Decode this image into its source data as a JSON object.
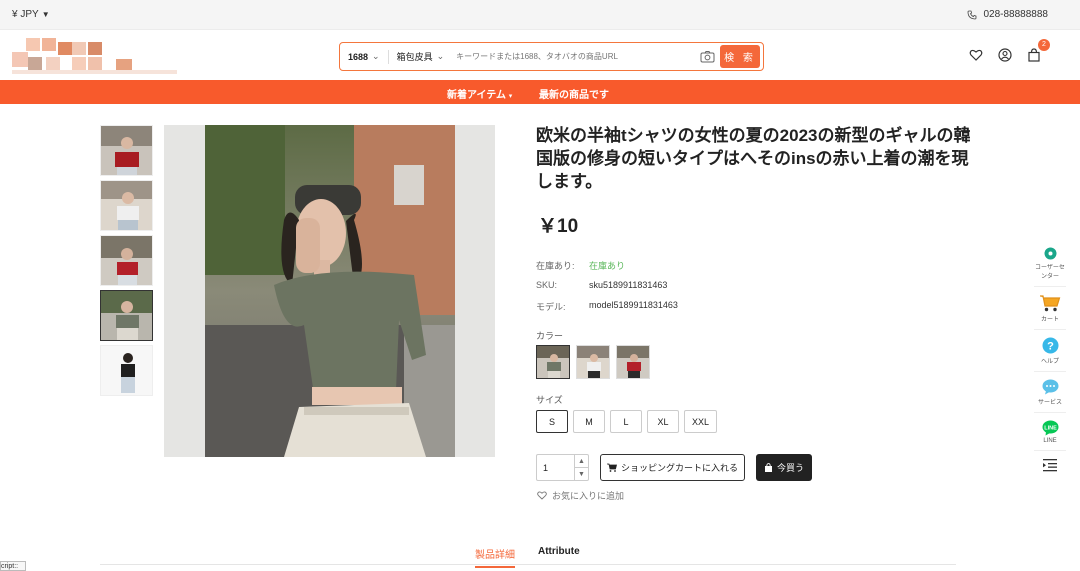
{
  "topbar": {
    "currency": "¥ JPY",
    "phone": "028-88888888"
  },
  "search": {
    "source_option": "1688",
    "category_option": "箱包皮具",
    "placeholder": "キーワードまたは1688、タオバオの商品URL",
    "button_label": "検 索"
  },
  "header": {
    "cart_badge": "2"
  },
  "nav": {
    "item1": "新着アイテム",
    "item2": "最新の商品です"
  },
  "product": {
    "title": "欧米の半袖tシャツの女性の夏の2023の新型のギャルの韓国版の修身の短いタイプはへそのinsの赤い上着の潮を現します。",
    "price": "￥10",
    "stock_label": "在庫あり:",
    "stock_value": "在庫あり",
    "sku_label": "SKU:",
    "sku_value": "sku5189911831463",
    "model_label": "モデル:",
    "model_value": "model5189911831463",
    "color_label": "カラー",
    "size_label": "サイズ",
    "sizes": [
      "S",
      "M",
      "L",
      "XL",
      "XXL"
    ],
    "selected_size": "S",
    "quantity": "1",
    "add_to_cart_label": "ショッピングカートに入れる",
    "buy_now_label": "今買う",
    "favorite_label": "お気に入りに追加"
  },
  "sidebar": {
    "items": [
      {
        "label": "コーザーセンター",
        "icon": "user-center-icon"
      },
      {
        "label": "カート",
        "icon": "cart-icon"
      },
      {
        "label": "ヘルプ",
        "icon": "help-icon"
      },
      {
        "label": "サービス",
        "icon": "chat-icon"
      },
      {
        "label": "LINE",
        "icon": "line-icon"
      }
    ]
  },
  "tabs": {
    "details": "製品詳細",
    "attribute": "Attribute"
  },
  "debug": {
    "label": "cript::"
  },
  "colors": {
    "accent": "#f85a2c",
    "button": "#f4683a",
    "in_stock": "#5cb85c"
  }
}
